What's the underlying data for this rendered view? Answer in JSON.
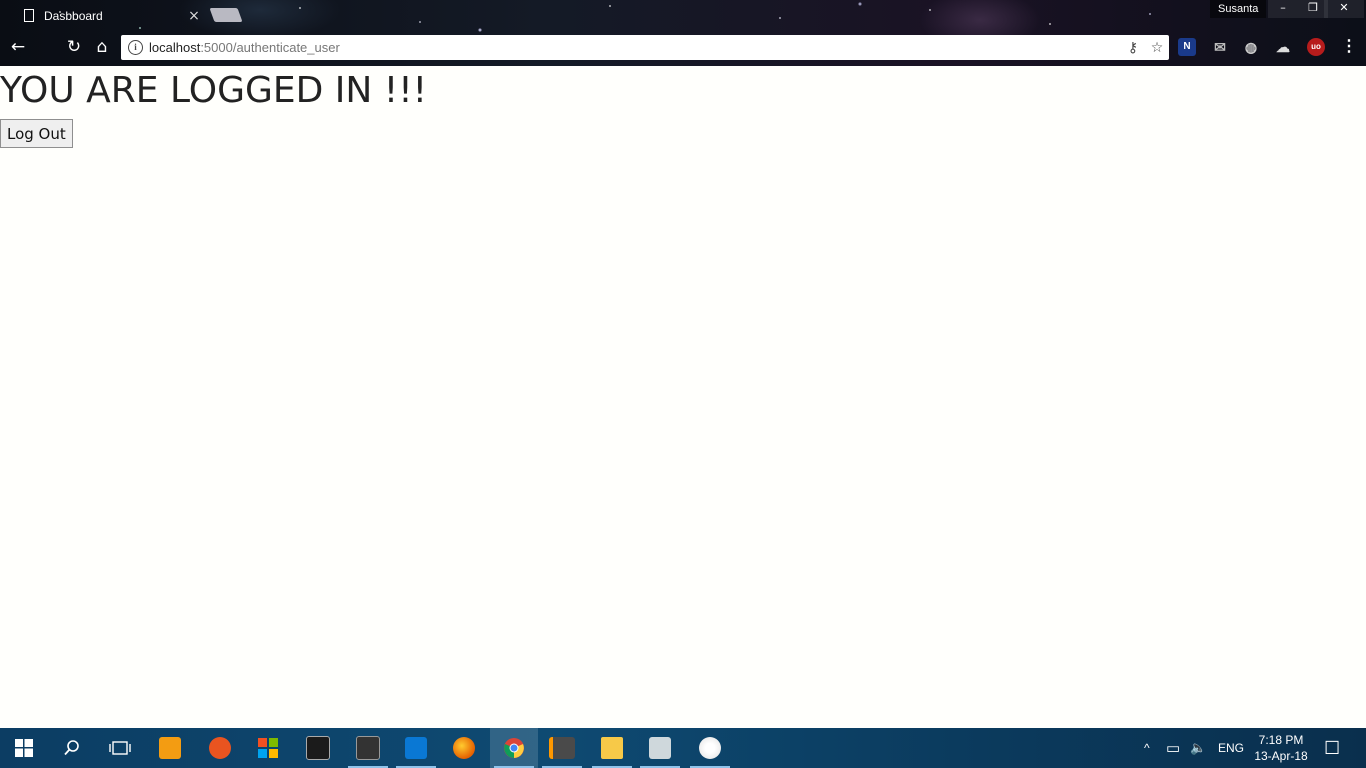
{
  "browser": {
    "tab_title": "Dasbboard",
    "tab_close": "×",
    "profile_name": "Susanta",
    "window_buttons": {
      "minimize": "–",
      "restore": "❐",
      "close": "✕"
    },
    "url_host": "localhost",
    "url_path": ":5000/authenticate_user",
    "nav": {
      "back": "←",
      "reload": "↻",
      "home": "⌂"
    },
    "omnibox_icons": {
      "key": "⚷",
      "star": "☆"
    },
    "extensions": [
      "N",
      "✉",
      "◍",
      "☁",
      "uo"
    ],
    "menu": "⋮"
  },
  "page": {
    "heading": "YOU ARE LOGGED IN !!!",
    "logout_label": "Log Out"
  },
  "taskbar": {
    "pinned": [
      "start",
      "search",
      "task-view",
      "media-player",
      "ubuntu",
      "store",
      "terminal",
      "cmd",
      "vscode",
      "firefox",
      "chrome",
      "sublime",
      "file-explorer",
      "task-manager",
      "paint"
    ],
    "tray": {
      "chevron": "^",
      "network": "▭",
      "volume": "🔈",
      "language": "ENG"
    },
    "time": "7:18 PM",
    "date": "13-Apr-18",
    "notifications": "☐"
  },
  "colors": {
    "taskbar_bg": "#0e4a72",
    "page_bg": "#fffffc",
    "heading_color": "#222222"
  }
}
